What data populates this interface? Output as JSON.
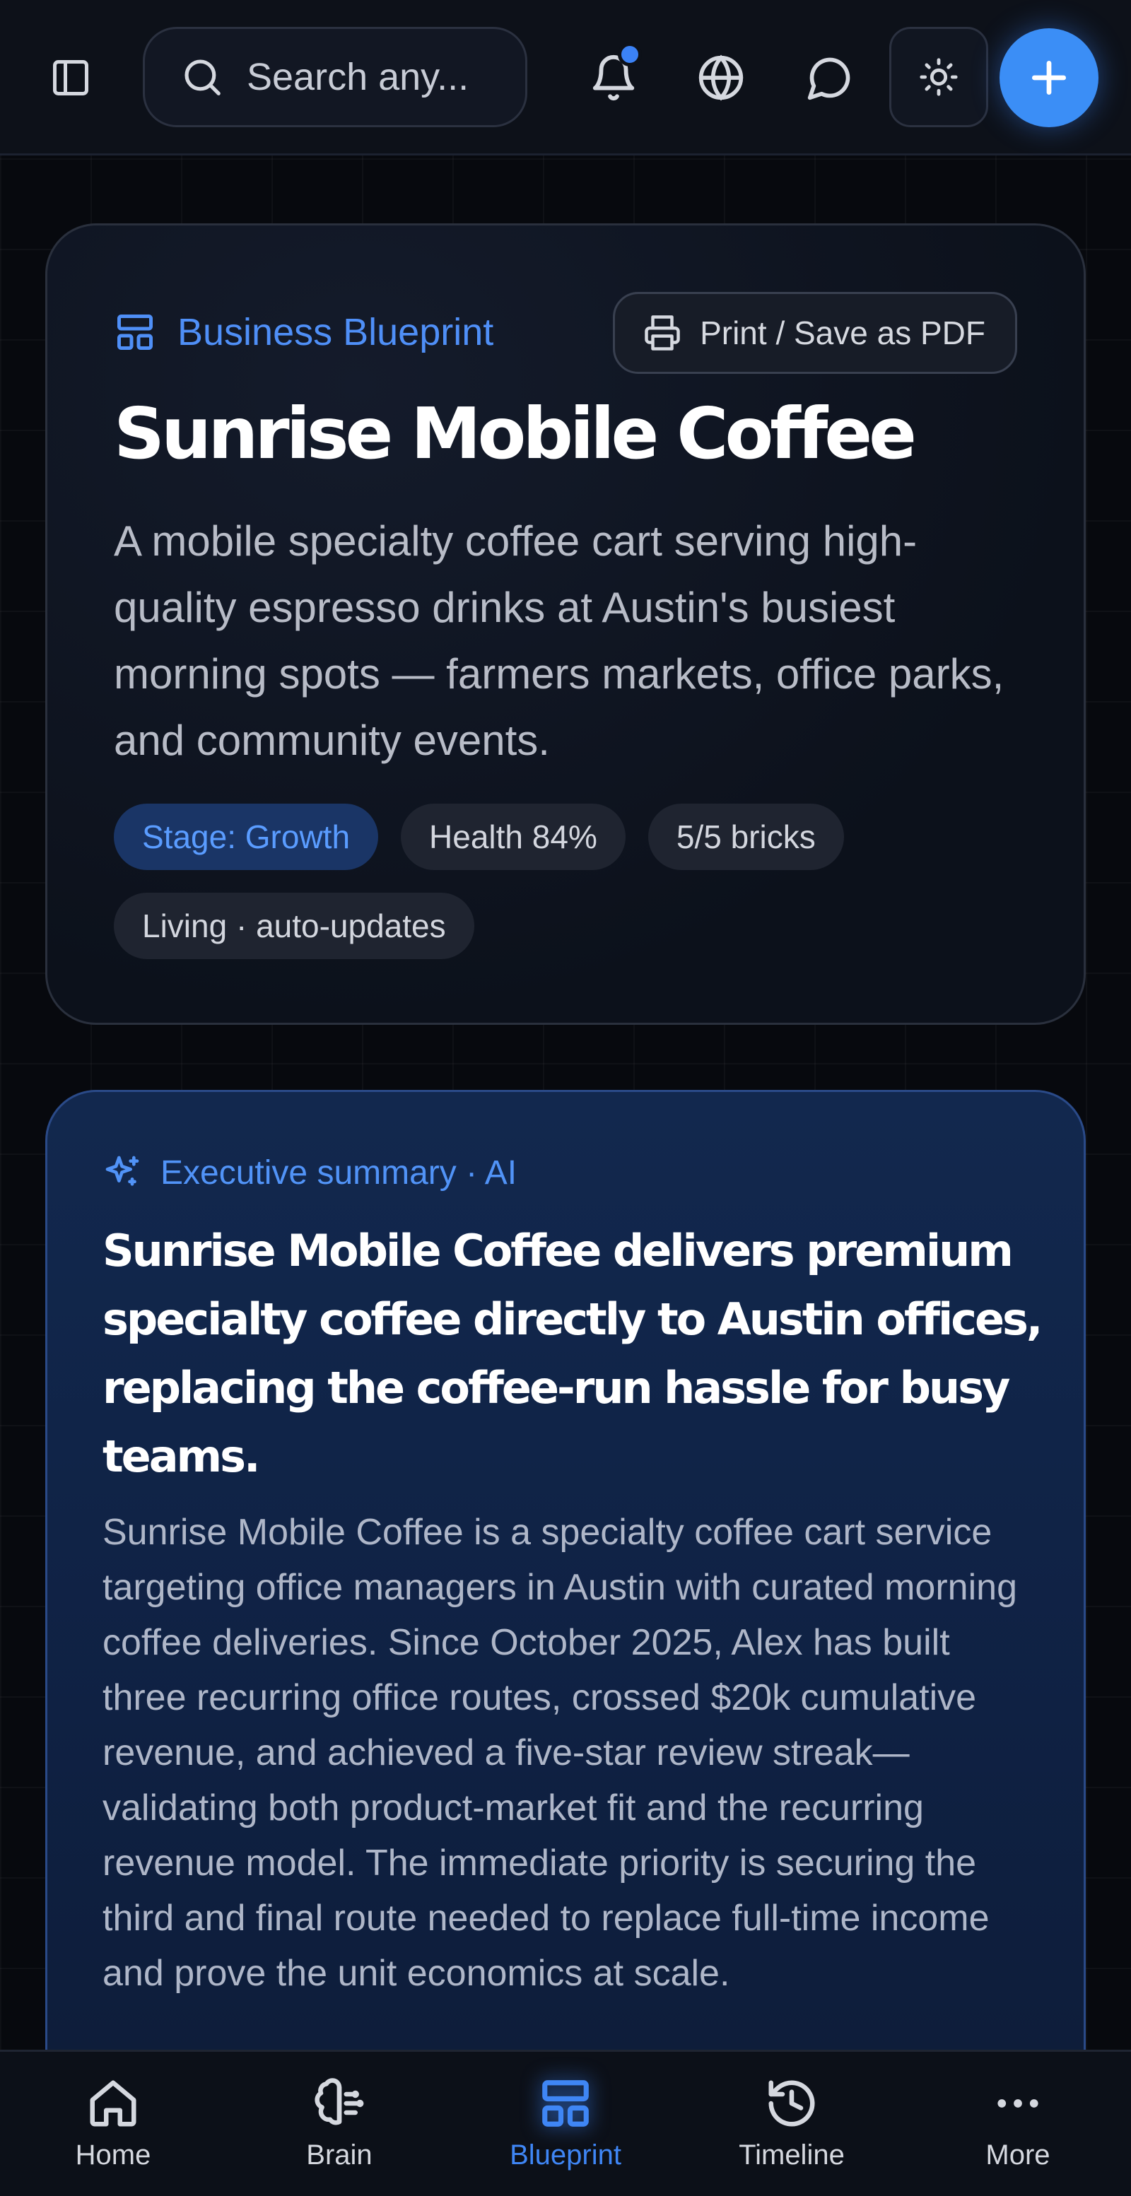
{
  "colors": {
    "accent": "#3b82f6",
    "background": "#07090e",
    "summary_bg": "#0f2143"
  },
  "topbar": {
    "search_placeholder": "Search any...",
    "icons": [
      "sidebar-toggle-icon",
      "search-icon",
      "bell-icon",
      "globe-icon",
      "chat-icon",
      "sun-icon",
      "plus-icon"
    ],
    "notification_dot": true
  },
  "hero": {
    "eyebrow": "Business Blueprint",
    "print_label": "Print / Save as PDF",
    "title": "Sunrise Mobile Coffee",
    "description": "A mobile specialty coffee cart serving high-quality espresso drinks at Austin's busiest morning spots — farmers markets, office parks, and community events.",
    "chips": {
      "stage": "Stage: Growth",
      "health": "Health 84%",
      "bricks": "5/5 bricks",
      "living": "Living · auto-updates"
    }
  },
  "summary": {
    "eyebrow": "Executive summary · AI",
    "headline": "Sunrise Mobile Coffee delivers premium specialty coffee directly to Austin offices, replacing the coffee-run hassle for busy teams.",
    "body": "Sunrise Mobile Coffee is a specialty coffee cart service targeting office managers in Austin with curated morning coffee deliveries. Since October 2025, Alex has built three recurring office routes, crossed $20k cumulative revenue, and achieved a five-star review streak—validating both product-market fit and the recurring revenue model. The immediate priority is securing the third and final route needed to replace full-time income and prove the unit economics at scale."
  },
  "nav": {
    "items": [
      {
        "label": "Home",
        "icon": "home-icon"
      },
      {
        "label": "Brain",
        "icon": "brain-icon"
      },
      {
        "label": "Blueprint",
        "icon": "blueprint-icon"
      },
      {
        "label": "Timeline",
        "icon": "history-icon"
      },
      {
        "label": "More",
        "icon": "more-icon"
      }
    ],
    "active": "Blueprint"
  }
}
